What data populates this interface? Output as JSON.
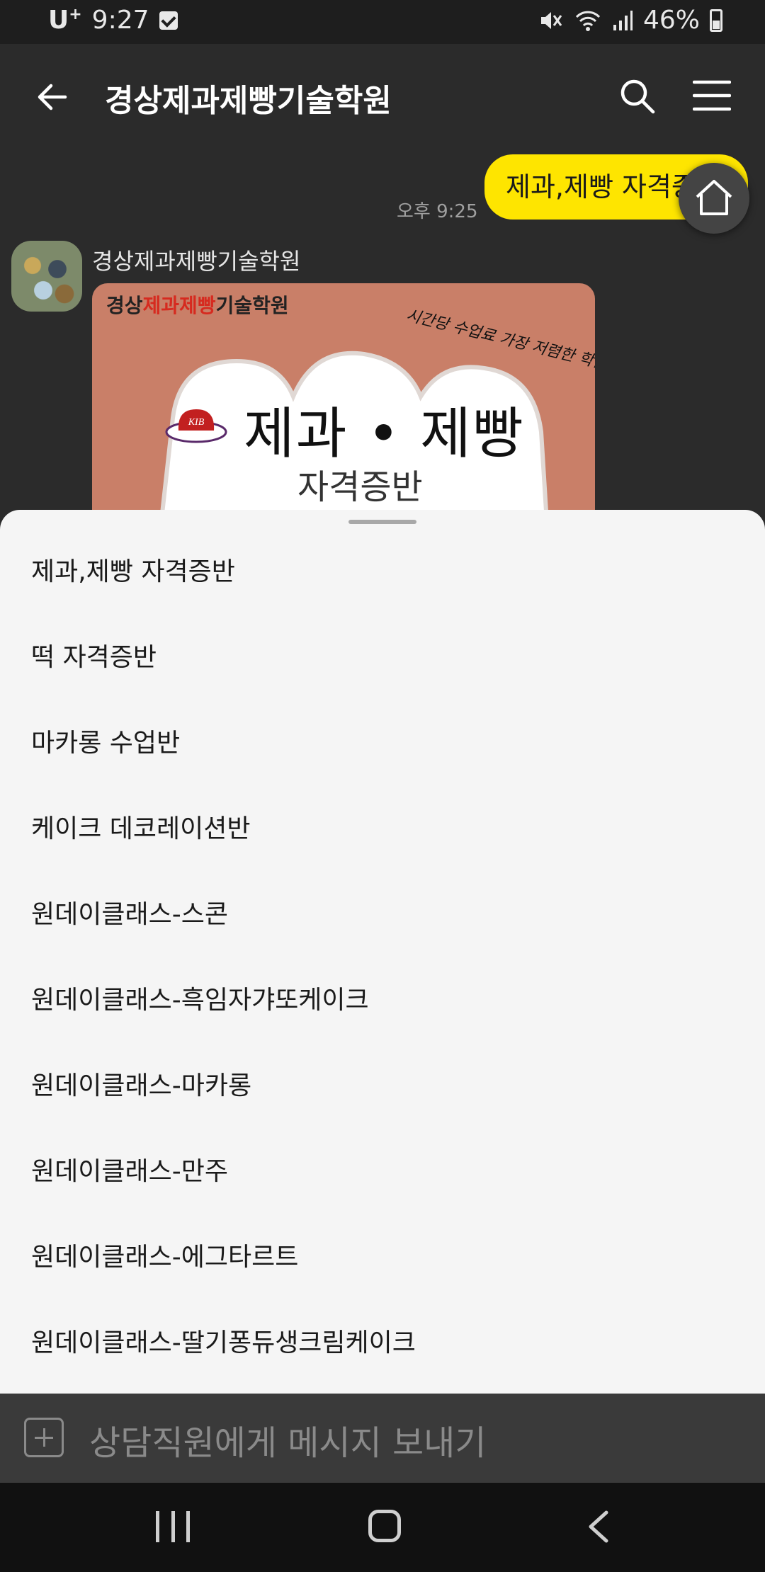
{
  "status_bar": {
    "carrier": "U",
    "carrier_sup": "+",
    "time": "9:27",
    "battery": "46%"
  },
  "app_bar": {
    "title": "경상제과제빵기술학원"
  },
  "chat": {
    "my_message": "제과,제빵 자격증반",
    "my_message_time": "오후 9:25",
    "sender_name": "경상제과제빵기술학원",
    "promo": {
      "brand_prefix": "경상",
      "brand_highlight": "제과제빵",
      "brand_suffix": "기술학원",
      "tagline": "시간당 수업료 가장 저렴한 학원!!",
      "logo_text": "KIB",
      "main": "제과 • 제빵",
      "sub": "자격증반"
    }
  },
  "sheet": {
    "items": [
      "제과,제빵 자격증반",
      "떡 자격증반",
      "마카롱 수업반",
      "케이크 데코레이션반",
      "원데이클래스-스콘",
      "원데이클래스-흑임자갸또케이크",
      "원데이클래스-마카롱",
      "원데이클래스-만주",
      "원데이클래스-에그타르트",
      "원데이클래스-딸기퐁듀생크림케이크"
    ]
  },
  "input": {
    "placeholder": "상담직원에게 메시지 보내기"
  },
  "colors": {
    "my_bubble": "#fee500",
    "card_bg": "#c97f68",
    "sheet_bg": "#f5f5f5"
  }
}
